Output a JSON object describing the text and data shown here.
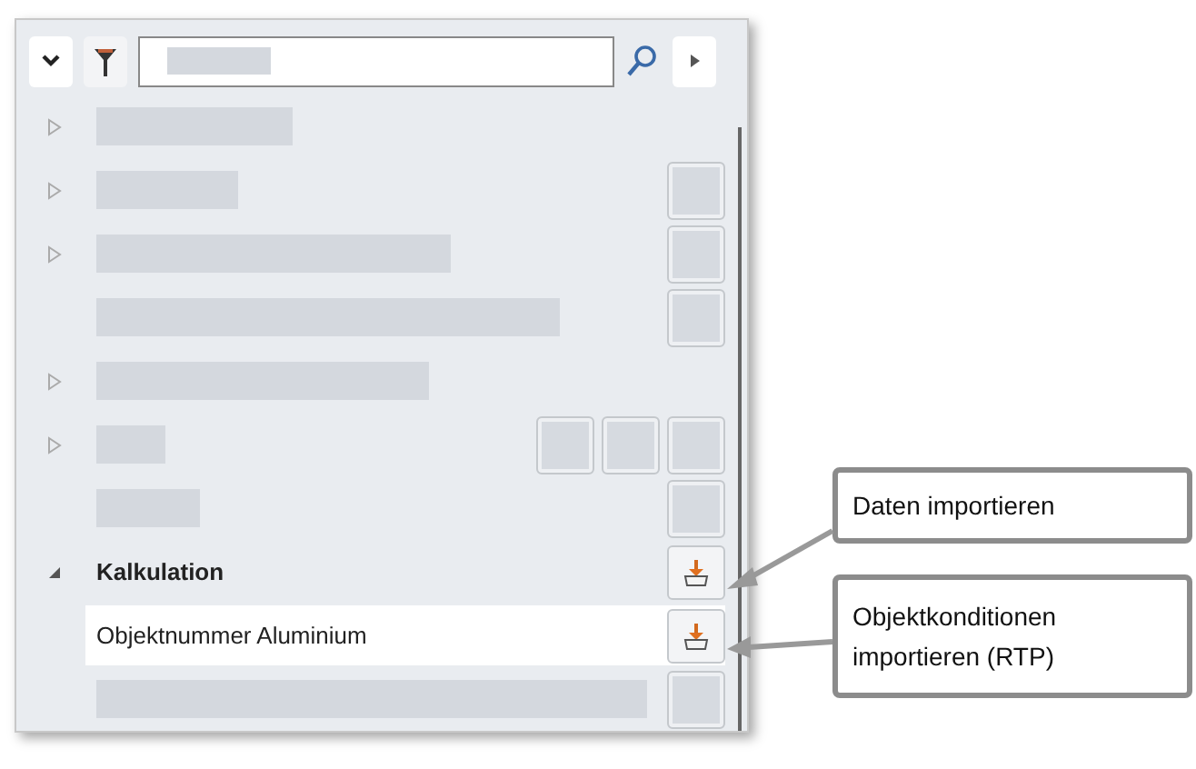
{
  "rows": [
    {
      "kind": "redacted",
      "expanded": false,
      "selected": false,
      "actions": []
    },
    {
      "kind": "redacted",
      "expanded": false,
      "selected": false,
      "actions": [
        {
          "kind": "blank"
        }
      ]
    },
    {
      "kind": "redacted",
      "expanded": false,
      "selected": false,
      "actions": [
        {
          "kind": "blank"
        }
      ]
    },
    {
      "kind": "redacted",
      "selected": false,
      "actions": [
        {
          "kind": "blank"
        }
      ]
    },
    {
      "kind": "redacted",
      "expanded": false,
      "selected": false,
      "actions": []
    },
    {
      "kind": "redacted",
      "expanded": false,
      "selected": false,
      "actions": [
        {
          "kind": "blank"
        },
        {
          "kind": "blank"
        },
        {
          "kind": "blank"
        }
      ]
    },
    {
      "kind": "redacted",
      "selected": false,
      "actions": [
        {
          "kind": "blank"
        }
      ]
    },
    {
      "kind": "group",
      "label": "Kalkulation",
      "expanded": true,
      "selected": false,
      "actions": [
        {
          "kind": "import"
        }
      ]
    },
    {
      "kind": "item",
      "label": "Objektnummer Aluminium",
      "selected": true,
      "actions": [
        {
          "kind": "import"
        }
      ]
    },
    {
      "kind": "redacted",
      "selected": false,
      "actions": [
        {
          "kind": "blank"
        }
      ]
    }
  ],
  "callouts": [
    {
      "text": "Daten importieren"
    },
    {
      "text": "Objektkonditionen importieren (RTP)"
    }
  ]
}
